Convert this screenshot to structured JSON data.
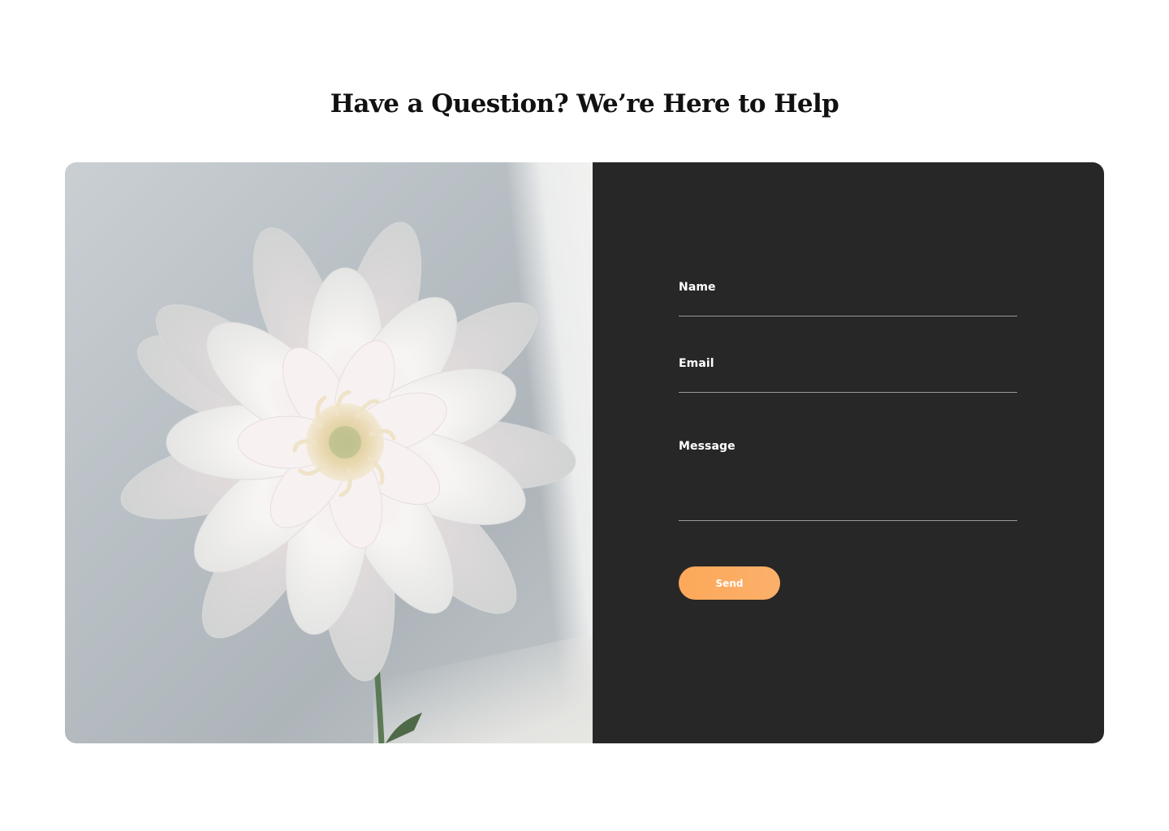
{
  "page": {
    "title": "Have a Question? We’re Here to Help"
  },
  "contact_form": {
    "name": {
      "label": "Name",
      "value": "",
      "placeholder": ""
    },
    "email": {
      "label": "Email",
      "value": "",
      "placeholder": ""
    },
    "message": {
      "label": "Message",
      "value": "",
      "placeholder": ""
    },
    "send_label": "Send"
  },
  "colors": {
    "form_background": "#272727",
    "button_accent": "#fca85b",
    "title_text": "#111111"
  },
  "image": {
    "subject": "white-flower-photo"
  }
}
